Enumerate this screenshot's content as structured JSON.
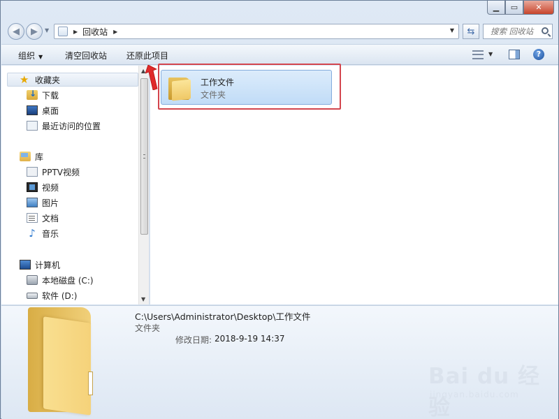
{
  "address_bar": {
    "breadcrumb": "回收站",
    "search_placeholder": "搜索 回收站"
  },
  "toolbar": {
    "organize_label": "组织",
    "empty_recycle_bin_label": "清空回收站",
    "restore_item_label": "还原此项目"
  },
  "navigation": {
    "favorites": {
      "label": "收藏夹",
      "items": [
        "下载",
        "桌面",
        "最近访问的位置"
      ]
    },
    "libraries": {
      "label": "库",
      "items": [
        "PPTV视频",
        "视频",
        "图片",
        "文档",
        "音乐"
      ]
    },
    "computer": {
      "label": "计算机",
      "items": [
        "本地磁盘 (C:)",
        "软件 (D:)"
      ]
    }
  },
  "content": {
    "items": [
      {
        "name": "工作文件",
        "type": "文件夹",
        "icon": "folder-icon"
      }
    ]
  },
  "details_pane": {
    "path": "C:\\Users\\Administrator\\Desktop\\工作文件",
    "type": "文件夹",
    "modified_label": "修改日期:",
    "modified_value": "2018-9-19 14:37"
  },
  "watermark": {
    "logo": "Bai du 经验",
    "url": "jingyan.baidu.com"
  },
  "colors": {
    "selection": "#c1dcf7",
    "annotation_red": "#d3454d"
  }
}
